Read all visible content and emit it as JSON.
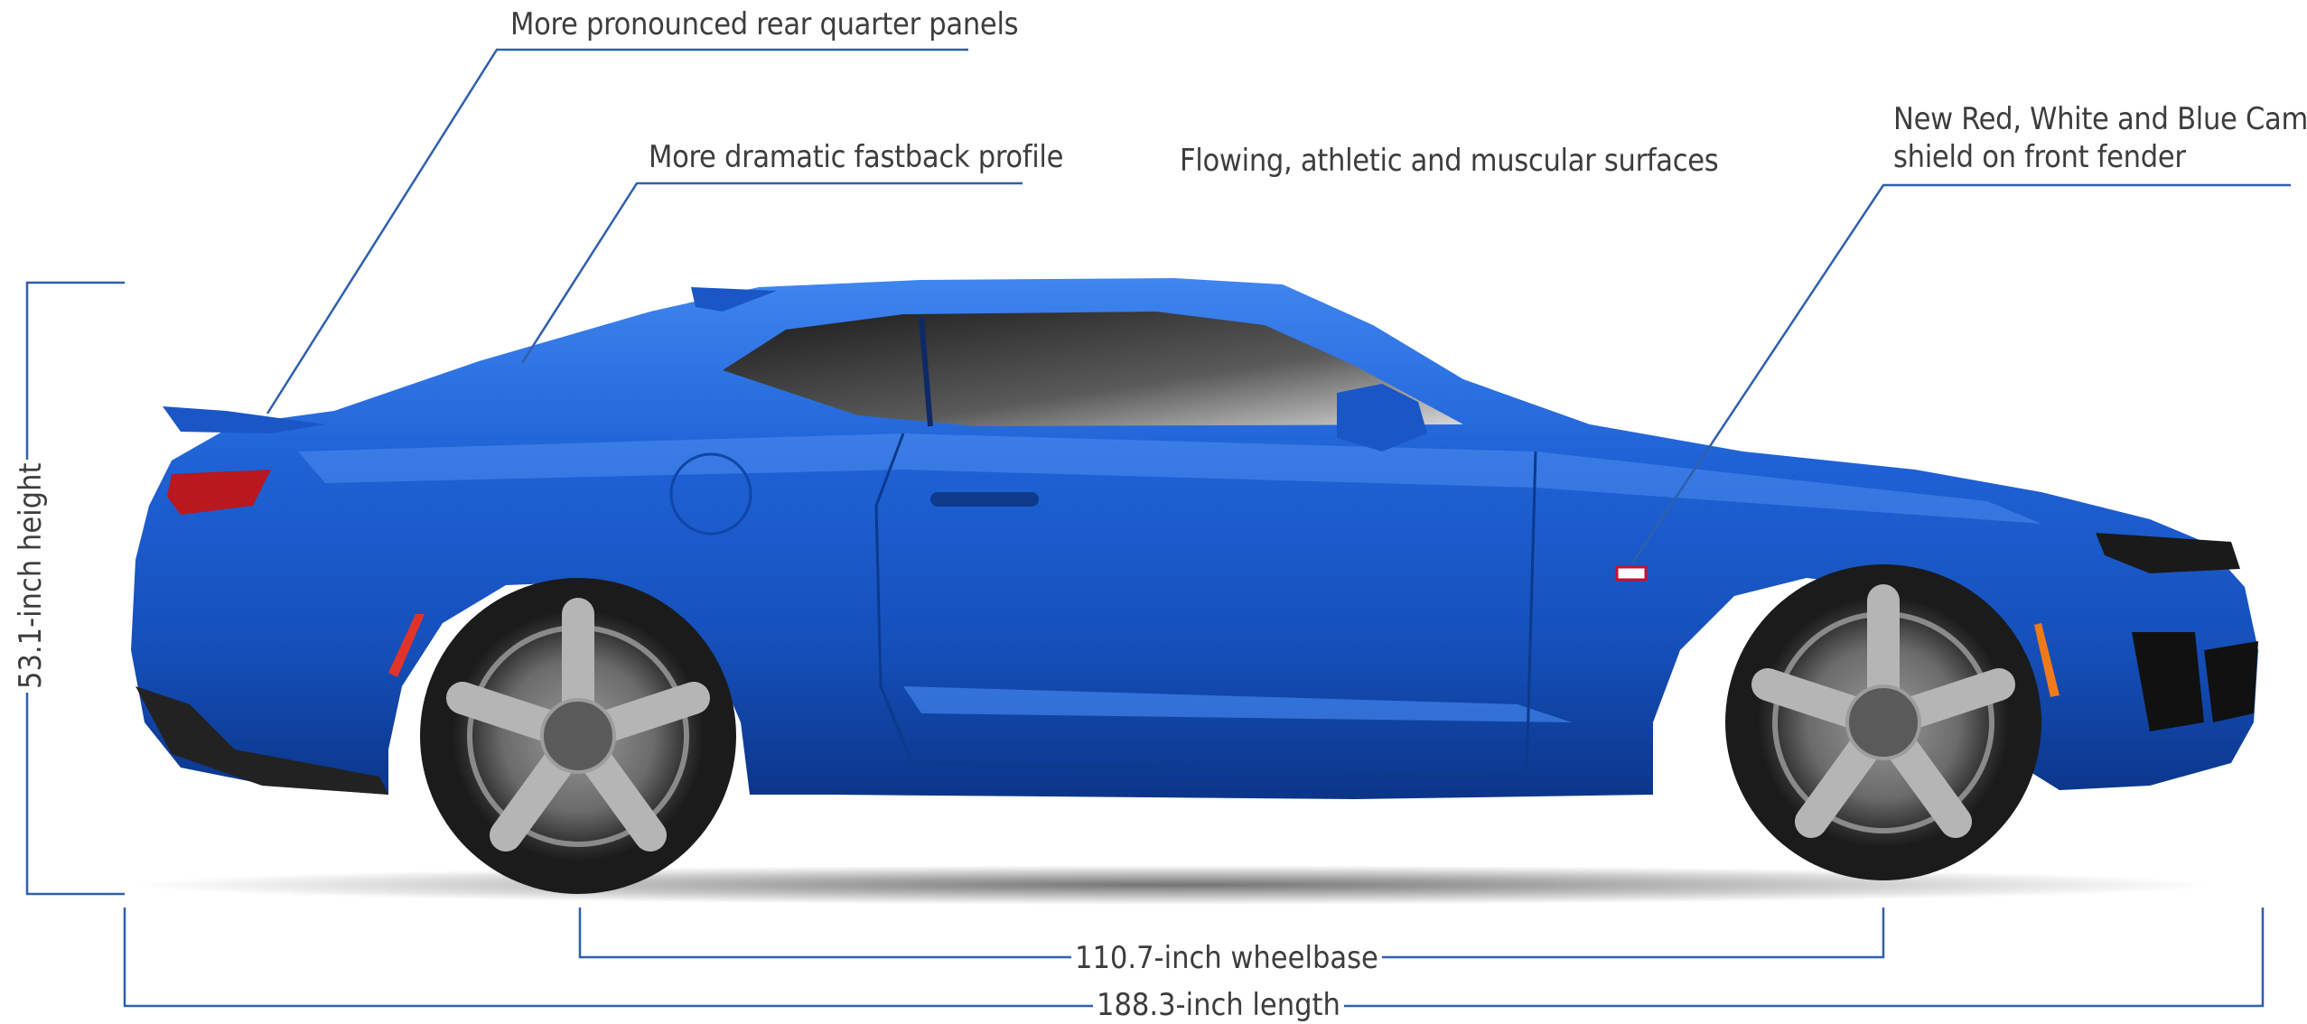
{
  "callouts": {
    "rear_quarter": "More pronounced rear quarter panels",
    "fastback": "More dramatic fastback profile",
    "surfaces": "Flowing, athletic and muscular surfaces",
    "shield_line1": "New Red, White and Blue Camaro",
    "shield_line2": "shield on front fender"
  },
  "dimensions": {
    "height": "53.1-inch height",
    "wheelbase": "110.7-inch wheelbase",
    "length": "188.3-inch length"
  },
  "colors": {
    "line": "#2f5fae",
    "text": "#3d3d3d",
    "car_body": "#1f5fd0",
    "car_dark": "#0d3a8a"
  }
}
